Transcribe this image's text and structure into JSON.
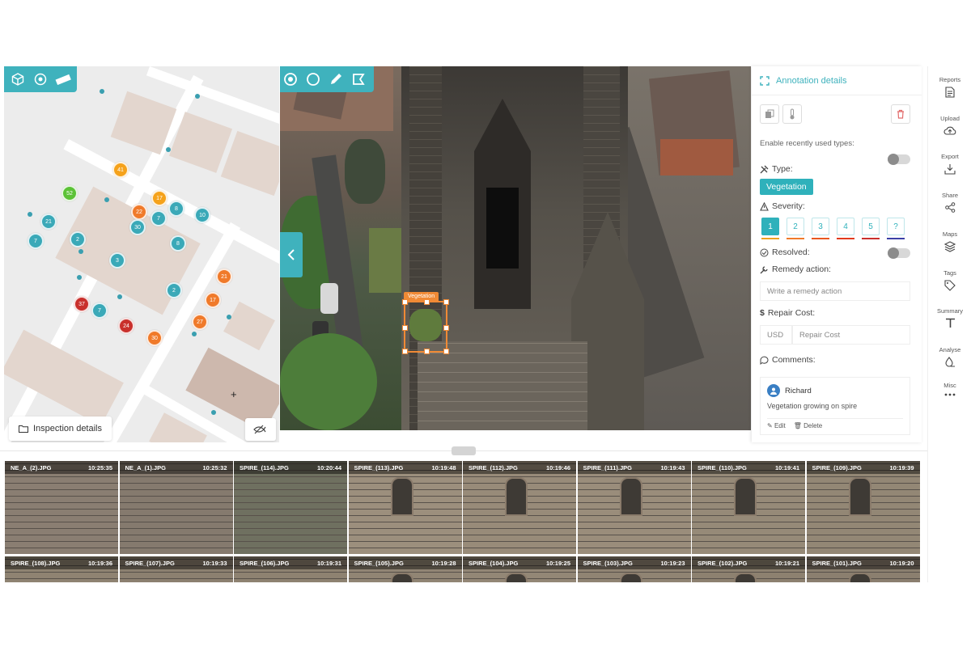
{
  "map": {
    "tools": [
      {
        "icon": "cube-icon"
      },
      {
        "icon": "target-icon"
      },
      {
        "icon": "ruler-icon"
      }
    ],
    "markers": [
      {
        "label": "41",
        "color": "#f5a21b"
      },
      {
        "label": "52",
        "color": "#5bc236"
      },
      {
        "label": "22",
        "color": "#f07a2a"
      },
      {
        "label": "17",
        "color": "#f5a21b"
      },
      {
        "label": "30",
        "color": "#3aa9b8"
      },
      {
        "label": "7",
        "color": "#3aa9b8"
      },
      {
        "label": "8",
        "color": "#3aa9b8"
      },
      {
        "label": "10",
        "color": "#3aa9b8"
      },
      {
        "label": "21",
        "color": "#3aa9b8"
      },
      {
        "label": "7",
        "color": "#3aa9b8"
      },
      {
        "label": "2",
        "color": "#3aa9b8"
      },
      {
        "label": "8",
        "color": "#3aa9b8"
      },
      {
        "label": "3",
        "color": "#3aa9b8"
      },
      {
        "label": "2",
        "color": "#3aa9b8"
      },
      {
        "label": "21",
        "color": "#f07a2a"
      },
      {
        "label": "17",
        "color": "#f07a2a"
      },
      {
        "label": "37",
        "color": "#c9302c"
      },
      {
        "label": "7",
        "color": "#3aa9b8"
      },
      {
        "label": "24",
        "color": "#c9302c"
      },
      {
        "label": "30",
        "color": "#f07a2a"
      },
      {
        "label": "27",
        "color": "#f07a2a"
      }
    ],
    "inspection_details_label": "Inspection details"
  },
  "viewer": {
    "annotation_label": "Vegetation"
  },
  "details": {
    "title": "Annotation details",
    "enable_recent_label": "Enable recently used types:",
    "type_label": "Type:",
    "type_value": "Vegetation",
    "severity_label": "Severity:",
    "severity_levels": [
      {
        "label": "1",
        "color": "#f0a01f"
      },
      {
        "label": "2",
        "color": "#f07a2a"
      },
      {
        "label": "3",
        "color": "#e8581f"
      },
      {
        "label": "4",
        "color": "#e23b1c"
      },
      {
        "label": "5",
        "color": "#c9302c"
      },
      {
        "label": "?",
        "color": "#3b3fa6"
      }
    ],
    "severity_selected": "1",
    "resolved_label": "Resolved:",
    "remedy_label": "Remedy action:",
    "remedy_placeholder": "Write a remedy action",
    "repair_label": "Repair Cost:",
    "currency": "USD",
    "repair_placeholder": "Repair Cost",
    "comments_label": "Comments:",
    "comment": {
      "author": "Richard",
      "text": "Vegetation growing on spire",
      "edit_label": "Edit",
      "delete_label": "Delete"
    }
  },
  "rail": {
    "items": [
      {
        "label": "Reports",
        "icon": "document-icon"
      },
      {
        "label": "Upload",
        "icon": "cloud-upload-icon"
      },
      {
        "label": "Export",
        "icon": "download-tray-icon"
      },
      {
        "label": "Share",
        "icon": "share-icon"
      },
      {
        "label": "Maps",
        "icon": "layers-icon"
      },
      {
        "label": "Tags",
        "icon": "tag-icon"
      },
      {
        "label": "Summary",
        "icon": "text-t-icon"
      },
      {
        "label": "Analyse",
        "icon": "drop-hand-icon"
      },
      {
        "label": "Misc",
        "icon": "more-dots-icon"
      }
    ]
  },
  "thumbnails": [
    {
      "name": "NE_A_(2).JPG",
      "time": "10:25:35",
      "tone": "#8a7e72"
    },
    {
      "name": "NE_A_(1).JPG",
      "time": "10:25:32",
      "tone": "#857a6e"
    },
    {
      "name": "SPIRE_(114).JPG",
      "time": "10:20:44",
      "tone": "#6f7060"
    },
    {
      "name": "SPIRE_(113).JPG",
      "time": "10:19:48",
      "tone": "#9c8f7d"
    },
    {
      "name": "SPIRE_(112).JPG",
      "time": "10:19:46",
      "tone": "#988b79"
    },
    {
      "name": "SPIRE_(111).JPG",
      "time": "10:19:43",
      "tone": "#9a8d7b"
    },
    {
      "name": "SPIRE_(110).JPG",
      "time": "10:19:41",
      "tone": "#968a78"
    },
    {
      "name": "SPIRE_(109).JPG",
      "time": "10:19:39",
      "tone": "#938775"
    },
    {
      "name": "SPIRE_(108).JPG",
      "time": "10:19:36",
      "tone": "#8f8372"
    },
    {
      "name": "SPIRE_(107).JPG",
      "time": "10:19:33",
      "tone": "#8c8070"
    },
    {
      "name": "SPIRE_(106).JPG",
      "time": "10:19:31",
      "tone": "#8e8271"
    },
    {
      "name": "SPIRE_(105).JPG",
      "time": "10:19:28",
      "tone": "#918574"
    },
    {
      "name": "SPIRE_(104).JPG",
      "time": "10:19:25",
      "tone": "#938776"
    },
    {
      "name": "SPIRE_(103).JPG",
      "time": "10:19:23",
      "tone": "#908473"
    },
    {
      "name": "SPIRE_(102).JPG",
      "time": "10:19:21",
      "tone": "#8d8170"
    },
    {
      "name": "SPIRE_(101).JPG",
      "time": "10:19:20",
      "tone": "#8b7f6f"
    }
  ]
}
